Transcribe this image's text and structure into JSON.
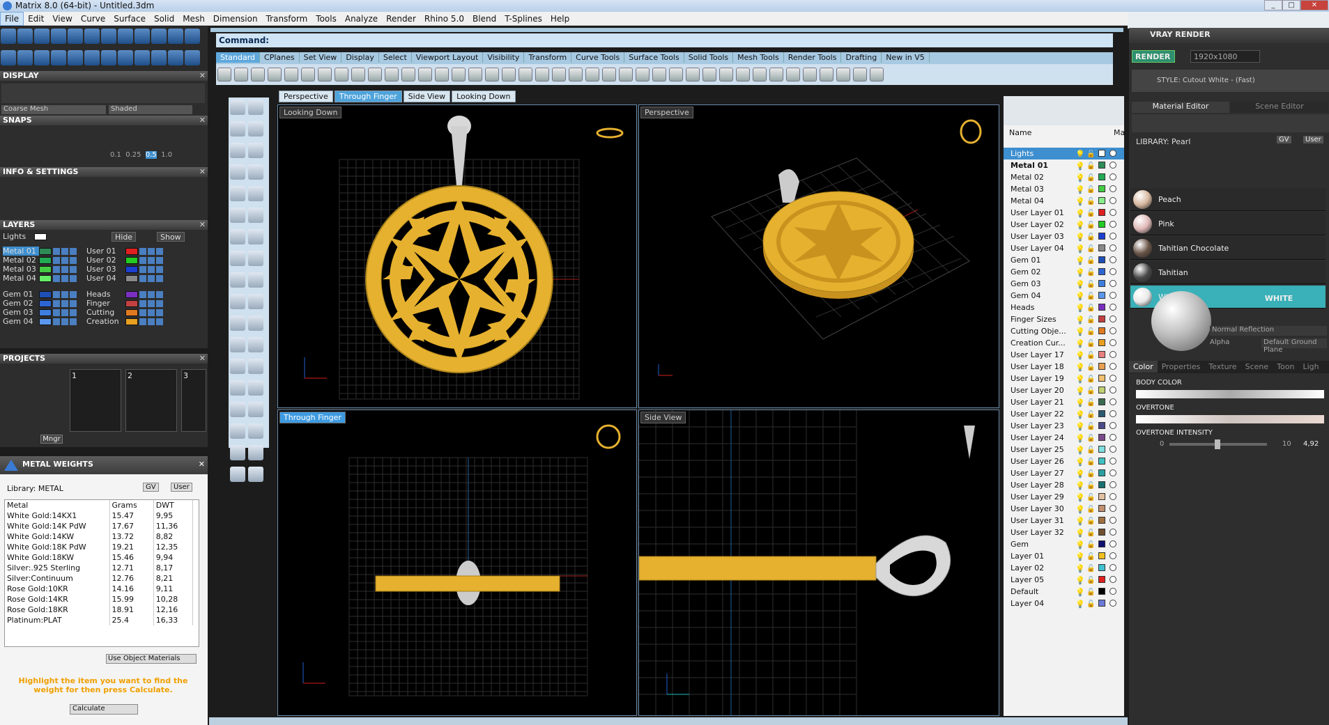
{
  "app": {
    "title": "Matrix 8.0 (64-bit) - Untitled.3dm"
  },
  "menu": [
    "File",
    "Edit",
    "View",
    "Curve",
    "Surface",
    "Solid",
    "Mesh",
    "Dimension",
    "Transform",
    "Tools",
    "Analyze",
    "Render",
    "Rhino 5.0",
    "Blend",
    "T-Splines",
    "Help"
  ],
  "left": {
    "display_title": "DISPLAY",
    "mesh_select": "Coarse Mesh",
    "shade_select": "Shaded",
    "snaps_title": "SNAPS",
    "snap_values": [
      "0.1",
      "0.25",
      "0.5",
      "1.0"
    ],
    "info_title": "INFO & SETTINGS",
    "layers_title": "LAYERS",
    "lights_label": "Lights",
    "hide_label": "Hide",
    "show_label": "Show",
    "layer_rows": [
      {
        "a": "Metal 01",
        "ac": "#2e8b57",
        "b": "User 01",
        "bc": "#e02020"
      },
      {
        "a": "Metal 02",
        "ac": "#22aa55",
        "b": "User 02",
        "bc": "#22cc22"
      },
      {
        "a": "Metal 03",
        "ac": "#44cc44",
        "b": "User 03",
        "bc": "#1d3fd0"
      },
      {
        "a": "Metal 04",
        "ac": "#66ee66",
        "b": "User 04",
        "bc": "#888888"
      },
      {
        "a": "Gem 01",
        "ac": "#1e4fb5",
        "b": "Heads",
        "bc": "#7a2fc0"
      },
      {
        "a": "Gem 02",
        "ac": "#2d66d4",
        "b": "Finger",
        "bc": "#c24040"
      },
      {
        "a": "Gem 03",
        "ac": "#3d7fe0",
        "b": "Cutting",
        "bc": "#e07a20"
      },
      {
        "a": "Gem 04",
        "ac": "#5a98ee",
        "b": "Creation",
        "bc": "#e8a020"
      }
    ],
    "projects_title": "PROJECTS",
    "project_slots": [
      "1",
      "2",
      "3"
    ],
    "mngr_label": "Mngr",
    "metal_title": "METAL WEIGHTS",
    "library_label": "Library: METAL",
    "gv_label": "GV",
    "user_label": "User",
    "metal_headers": [
      "Metal",
      "Grams",
      "DWT"
    ],
    "metals": [
      [
        "White Gold:14KX1",
        "15.47",
        "9,95"
      ],
      [
        "White Gold:14K PdW",
        "17.67",
        "11,36"
      ],
      [
        "White Gold:14KW",
        "13.72",
        "8,82"
      ],
      [
        "White Gold:18K PdW",
        "19.21",
        "12,35"
      ],
      [
        "White Gold:18KW",
        "15.46",
        "9,94"
      ],
      [
        "Silver:.925 Sterling",
        "12.71",
        "8,17"
      ],
      [
        "Silver:Continuum",
        "12.76",
        "8,21"
      ],
      [
        "Rose Gold:10KR",
        "14.16",
        "9,11"
      ],
      [
        "Rose Gold:14KR",
        "15.99",
        "10,28"
      ],
      [
        "Rose Gold:18KR",
        "18.91",
        "12,16"
      ],
      [
        "Platinum:PLAT",
        "25.4",
        "16,33"
      ]
    ],
    "use_object_materials": "Use Object Materials",
    "hint": "Highlight the item you want to find the weight for then press Calculate.",
    "calculate_label": "Calculate"
  },
  "command_label": "Command:",
  "toolbar_tabs": [
    "Standard",
    "CPlanes",
    "Set View",
    "Display",
    "Select",
    "Viewport Layout",
    "Visibility",
    "Transform",
    "Curve Tools",
    "Surface Tools",
    "Solid Tools",
    "Mesh Tools",
    "Render Tools",
    "Drafting",
    "New in V5"
  ],
  "view_tabs": [
    "Perspective",
    "Through Finger",
    "Side View",
    "Looking Down"
  ],
  "viewports": [
    "Looking Down",
    "Perspective",
    "Through Finger",
    "Side View"
  ],
  "layers_panel": {
    "header": "Name",
    "mat_header": "Ma",
    "rows": [
      {
        "n": "Lights",
        "c": "#ffffff",
        "sel": true
      },
      {
        "n": "Metal 01",
        "c": "#2e8b57",
        "bold": true
      },
      {
        "n": "Metal 02",
        "c": "#22aa55"
      },
      {
        "n": "Metal 03",
        "c": "#44cc44"
      },
      {
        "n": "Metal 04",
        "c": "#88ee88"
      },
      {
        "n": "User Layer 01",
        "c": "#e02020"
      },
      {
        "n": "User Layer 02",
        "c": "#22cc22"
      },
      {
        "n": "User Layer 03",
        "c": "#1d3fd0"
      },
      {
        "n": "User Layer 04",
        "c": "#888888"
      },
      {
        "n": "Gem 01",
        "c": "#1e4fb5"
      },
      {
        "n": "Gem 02",
        "c": "#2d66d4"
      },
      {
        "n": "Gem 03",
        "c": "#3d7fe0"
      },
      {
        "n": "Gem 04",
        "c": "#5a98ee"
      },
      {
        "n": "Heads",
        "c": "#7a2fc0"
      },
      {
        "n": "Finger Sizes",
        "c": "#c24040"
      },
      {
        "n": "Cutting Obje...",
        "c": "#e07a20"
      },
      {
        "n": "Creation Cur...",
        "c": "#e8a020"
      },
      {
        "n": "User Layer 17",
        "c": "#e88080"
      },
      {
        "n": "User Layer 18",
        "c": "#e8a050"
      },
      {
        "n": "User Layer 19",
        "c": "#f0c070"
      },
      {
        "n": "User Layer 20",
        "c": "#c0d070"
      },
      {
        "n": "User Layer 21",
        "c": "#3a6a50"
      },
      {
        "n": "User Layer 22",
        "c": "#2a5a70"
      },
      {
        "n": "User Layer 23",
        "c": "#4a4a8a"
      },
      {
        "n": "User Layer 24",
        "c": "#7a4a8a"
      },
      {
        "n": "User Layer 25",
        "c": "#80e0e0"
      },
      {
        "n": "User Layer 26",
        "c": "#40c0c0"
      },
      {
        "n": "User Layer 27",
        "c": "#2aa0a0"
      },
      {
        "n": "User Layer 28",
        "c": "#1a7070"
      },
      {
        "n": "User Layer 29",
        "c": "#e0c0a0"
      },
      {
        "n": "User Layer 30",
        "c": "#c09070"
      },
      {
        "n": "User Layer 31",
        "c": "#a07040"
      },
      {
        "n": "User Layer 32",
        "c": "#705030"
      },
      {
        "n": "Gem",
        "c": "#101070"
      },
      {
        "n": "Layer 01",
        "c": "#f0c020"
      },
      {
        "n": "Layer 02",
        "c": "#40c0d0"
      },
      {
        "n": "Layer 05",
        "c": "#e02020"
      },
      {
        "n": "Default",
        "c": "#000000"
      },
      {
        "n": "Layer 04",
        "c": "#6a7ad8"
      }
    ]
  },
  "vray": {
    "title": "VRAY RENDER",
    "render_label": "RENDER",
    "resolution": "1920x1080",
    "style_label": "STYLE:",
    "style_value": "Cutout White - (Fast)",
    "tab_material": "Material Editor",
    "tab_scene": "Scene Editor",
    "library_label": "LIBRARY: Pearl",
    "gv_label": "GV",
    "user_label": "User",
    "materials": [
      {
        "n": "Peach",
        "c": "#d8b8a0"
      },
      {
        "n": "Pink",
        "c": "#e0b8b8"
      },
      {
        "n": "Tahitian Chocolate",
        "c": "#6a5548"
      },
      {
        "n": "Tahitian",
        "c": "#4a4a4a"
      },
      {
        "n": "White",
        "c": "#e8e8e8",
        "sel": true
      }
    ],
    "preview_name": "WHITE",
    "normal_reflection": "Normal Reflection",
    "alpha_label": "Alpha",
    "ground_plane": "Default Ground Plane",
    "prop_tabs": [
      "Color",
      "Properties",
      "Texture",
      "Scene",
      "Toon",
      "Ligh"
    ],
    "body_color": "BODY COLOR",
    "overtone": "OVERTONE",
    "overtone_intensity": "OVERTONE INTENSITY",
    "intensity_min": "0",
    "intensity_max": "10",
    "intensity_value": "4,92"
  }
}
